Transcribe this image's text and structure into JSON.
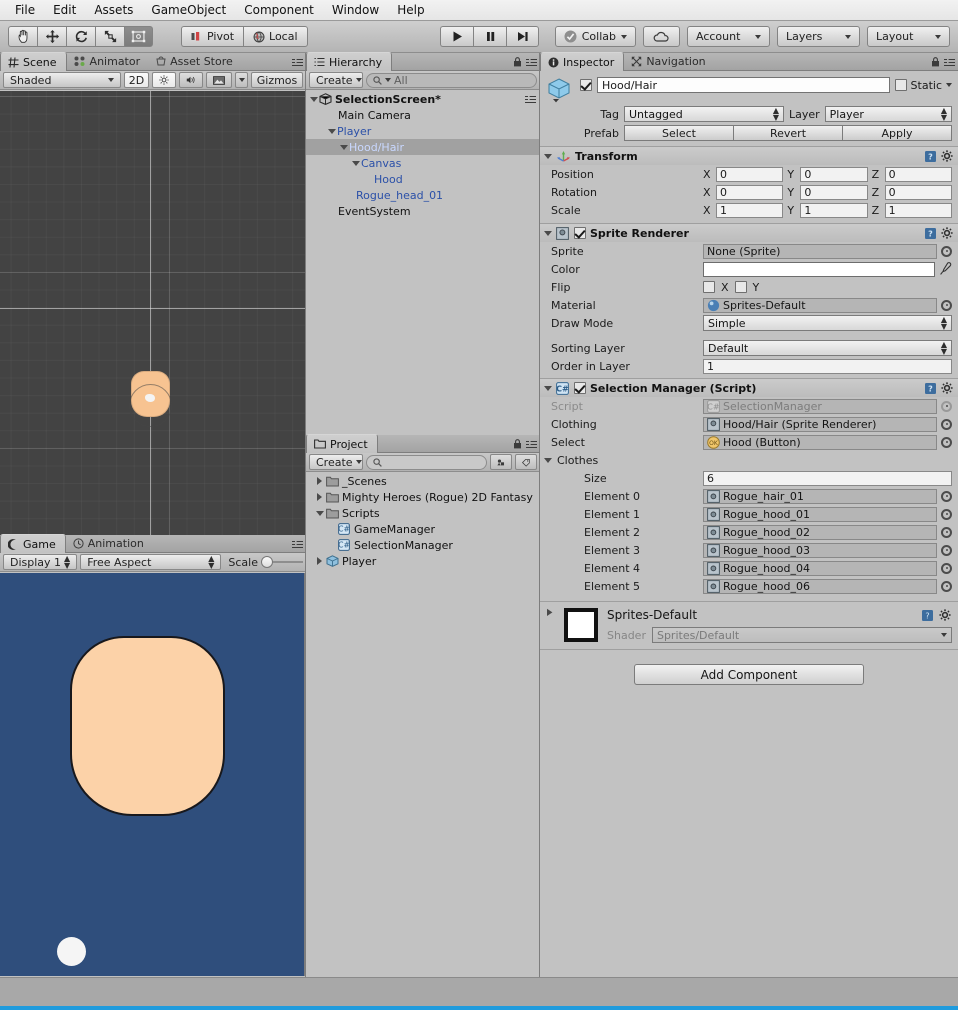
{
  "menubar": {
    "items": [
      "File",
      "Edit",
      "Assets",
      "GameObject",
      "Component",
      "Window",
      "Help"
    ]
  },
  "toolbar": {
    "tools": [
      {
        "name": "hand-tool",
        "icon": "hand-icon",
        "selected": false
      },
      {
        "name": "move-tool",
        "icon": "move-icon",
        "selected": false
      },
      {
        "name": "rotate-tool",
        "icon": "rotate-icon",
        "selected": false
      },
      {
        "name": "scale-tool",
        "icon": "scale-icon",
        "selected": false
      },
      {
        "name": "rect-tool",
        "icon": "rect-transform-icon",
        "selected": true
      }
    ],
    "pivot_label": "Pivot",
    "local_label": "Local",
    "play_label": "play-icon",
    "pause_label": "pause-icon",
    "step_label": "step-icon",
    "collab_label": "Collab",
    "cloud_label": "cloud-icon",
    "account_label": "Account",
    "layers_label": "Layers",
    "layout_label": "Layout"
  },
  "scene_panel": {
    "tabs": [
      "Scene",
      "Animator",
      "Asset Store"
    ],
    "active_tab": "Scene",
    "shading_mode": "Shaded",
    "mode_2d": "2D",
    "gizmos_label": "Gizmos"
  },
  "game_panel": {
    "tabs": [
      "Game",
      "Animation"
    ],
    "active_tab": "Game",
    "display": "Display 1",
    "aspect": "Free Aspect",
    "scale_label": "Scale"
  },
  "hierarchy": {
    "tab": "Hierarchy",
    "create_label": "Create",
    "search_placeholder": "All",
    "items": [
      {
        "label": "SelectionScreen*",
        "depth": 0,
        "arrow": "down",
        "bold": true,
        "blue": false,
        "selected": false,
        "scene_icon": true
      },
      {
        "label": "Main Camera",
        "depth": 1,
        "arrow": "none",
        "bold": false,
        "blue": false,
        "selected": false,
        "scene_icon": false
      },
      {
        "label": "Player",
        "depth": 1,
        "arrow": "down",
        "bold": false,
        "blue": true,
        "selected": false,
        "scene_icon": false
      },
      {
        "label": "Hood/Hair",
        "depth": 2,
        "arrow": "down",
        "bold": false,
        "blue": true,
        "selected": true,
        "scene_icon": false
      },
      {
        "label": "Canvas",
        "depth": 3,
        "arrow": "down",
        "bold": false,
        "blue": true,
        "selected": false,
        "scene_icon": false
      },
      {
        "label": "Hood",
        "depth": 4,
        "arrow": "none",
        "bold": false,
        "blue": true,
        "selected": false,
        "scene_icon": false
      },
      {
        "label": "Rogue_head_01",
        "depth": 3,
        "arrow": "none",
        "bold": false,
        "blue": true,
        "selected": false,
        "scene_icon": false
      },
      {
        "label": "EventSystem",
        "depth": 1,
        "arrow": "none",
        "bold": false,
        "blue": false,
        "selected": false,
        "scene_icon": false
      }
    ]
  },
  "project": {
    "tab": "Project",
    "create_label": "Create",
    "search_placeholder": "",
    "items": [
      {
        "label": "_Scenes",
        "depth": 0,
        "arrow": "right",
        "icon": "folder-icon"
      },
      {
        "label": "Mighty Heroes (Rogue) 2D Fantasy",
        "depth": 0,
        "arrow": "right",
        "icon": "folder-icon"
      },
      {
        "label": "Scripts",
        "depth": 0,
        "arrow": "down",
        "icon": "folder-icon"
      },
      {
        "label": "GameManager",
        "depth": 1,
        "arrow": "none",
        "icon": "csharp-script-icon"
      },
      {
        "label": "SelectionManager",
        "depth": 1,
        "arrow": "none",
        "icon": "csharp-script-icon"
      },
      {
        "label": "Player",
        "depth": 0,
        "arrow": "right",
        "icon": "prefab-icon"
      }
    ]
  },
  "inspector": {
    "tabs": [
      "Inspector",
      "Navigation"
    ],
    "active_tab": "Inspector",
    "object": {
      "enabled": true,
      "name": "Hood/Hair",
      "static_label": "Static",
      "static_checked": false,
      "tag_label": "Tag",
      "tag_value": "Untagged",
      "layer_label": "Layer",
      "layer_value": "Player",
      "prefab_label": "Prefab",
      "prefab_buttons": [
        "Select",
        "Revert",
        "Apply"
      ]
    },
    "transform": {
      "title": "Transform",
      "rows": [
        {
          "label": "Position",
          "x": "0",
          "y": "0",
          "z": "0"
        },
        {
          "label": "Rotation",
          "x": "0",
          "y": "0",
          "z": "0"
        },
        {
          "label": "Scale",
          "x": "1",
          "y": "1",
          "z": "1"
        }
      ]
    },
    "sprite_renderer": {
      "title": "Sprite Renderer",
      "enabled": true,
      "sprite_label": "Sprite",
      "sprite_value": "None (Sprite)",
      "color_label": "Color",
      "color_value": "#FFFFFF",
      "flip_label": "Flip",
      "flip_x_label": "X",
      "flip_y_label": "Y",
      "flip_x": false,
      "flip_y": false,
      "material_label": "Material",
      "material_value": "Sprites-Default",
      "draw_mode_label": "Draw Mode",
      "draw_mode_value": "Simple",
      "sorting_layer_label": "Sorting Layer",
      "sorting_layer_value": "Default",
      "order_label": "Order in Layer",
      "order_value": "1"
    },
    "selection_manager": {
      "title": "Selection Manager (Script)",
      "enabled": true,
      "script_label": "Script",
      "script_value": "SelectionManager",
      "clothing_label": "Clothing",
      "clothing_value": "Hood/Hair (Sprite Renderer)",
      "select_label": "Select",
      "select_value": "Hood (Button)",
      "clothes_label": "Clothes",
      "size_label": "Size",
      "size_value": "6",
      "elements": [
        {
          "label": "Element 0",
          "value": "Rogue_hair_01"
        },
        {
          "label": "Element 1",
          "value": "Rogue_hood_01"
        },
        {
          "label": "Element 2",
          "value": "Rogue_hood_02"
        },
        {
          "label": "Element 3",
          "value": "Rogue_hood_03"
        },
        {
          "label": "Element 4",
          "value": "Rogue_hood_04"
        },
        {
          "label": "Element 5",
          "value": "Rogue_hood_06"
        }
      ]
    },
    "material": {
      "name": "Sprites-Default",
      "shader_label": "Shader",
      "shader_value": "Sprites/Default"
    },
    "add_component_label": "Add Component"
  },
  "colors": {
    "panel_bg": "#c2c2c2",
    "scene_bg": "#434343",
    "game_bg": "#2f4e7c",
    "skin": "#fcd2a8",
    "hierarchy_blue": "#2b50a8",
    "selection": "#a1a1a1",
    "accent_bottom": "#1f9bdd"
  }
}
